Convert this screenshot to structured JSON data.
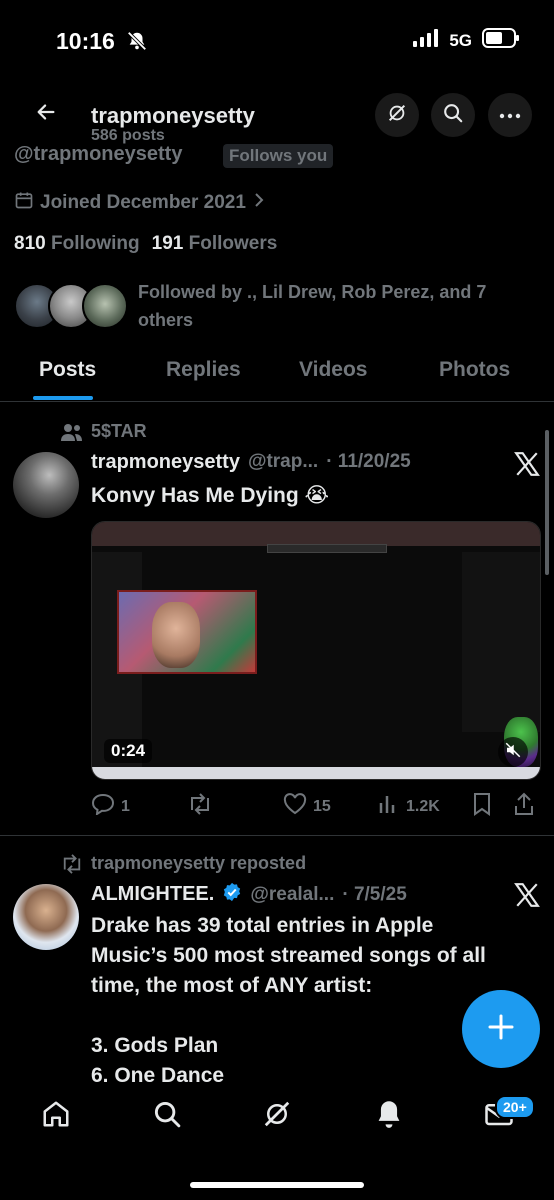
{
  "status_bar": {
    "time": "10:16",
    "network": "5G"
  },
  "header": {
    "title": "trapmoneysetty",
    "posts_count": "586 posts"
  },
  "profile": {
    "handle": "@trapmoneysetty",
    "follows_you": "Follows you",
    "joined": "Joined December 2021",
    "following_count": "810",
    "following_label": "Following",
    "followers_count": "191",
    "followers_label": "Followers",
    "followed_by": "Followed by ., Lil Drew, Rob Perez, and 7 others"
  },
  "tabs": [
    {
      "label": "Posts",
      "active": true
    },
    {
      "label": "Replies",
      "active": false
    },
    {
      "label": "Videos",
      "active": false
    },
    {
      "label": "Photos",
      "active": false
    }
  ],
  "post1": {
    "context": "5$TAR",
    "author": "trapmoneysetty",
    "handle": "@trap...",
    "date": "· 11/20/25",
    "text": "Konvy Has Me Dying 😭",
    "video_time": "0:24",
    "replies": "1",
    "reposts": "",
    "likes": "15",
    "views": "1.2K"
  },
  "post2": {
    "repost_label": "trapmoneysetty reposted",
    "author": "ALMIGHTEE.",
    "handle": "@realal...",
    "date": "· 7/5/25",
    "text_lines": [
      "Drake has 39 total entries in Apple",
      "Music’s 500 most streamed songs of all",
      "time, the most of ANY artist:",
      "",
      "3. Gods Plan",
      "6. One Dance"
    ]
  },
  "nav": {
    "badge": "20+"
  },
  "colors": {
    "accent": "#1d9bf0",
    "muted": "#71767b",
    "text": "#e7e9ea",
    "background": "#000000"
  }
}
